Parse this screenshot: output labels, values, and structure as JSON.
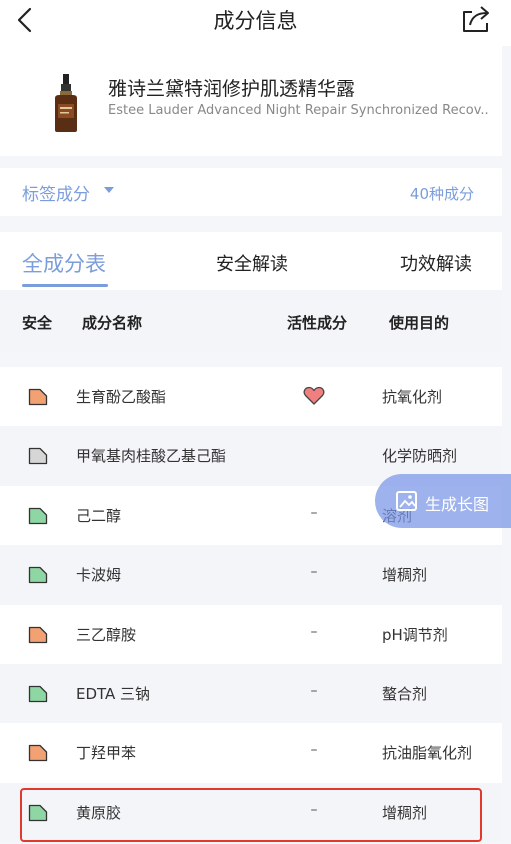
{
  "header": {
    "title": "成分信息",
    "back_icon": "chevron-left-icon",
    "share_icon": "share-icon"
  },
  "product": {
    "name": "雅诗兰黛特润修护肌透精华露",
    "name_en": "Estee Lauder Advanced Night Repair Synchronized Recov..."
  },
  "labels": {
    "link": "标签成分",
    "count": "40种成分"
  },
  "tabs": [
    {
      "label": "全成分表",
      "active": true
    },
    {
      "label": "安全解读",
      "active": false
    },
    {
      "label": "功效解读",
      "active": false
    }
  ],
  "table": {
    "headers": [
      "安全",
      "成分名称",
      "活性成分",
      "使用目的"
    ],
    "rows": [
      {
        "safety_color": "#f2a173",
        "name": "生育酚乙酸酯",
        "active": "heart",
        "purpose": "抗氧化剂"
      },
      {
        "safety_color": "#d6d6d6",
        "name": "甲氧基肉桂酸乙基己酯",
        "active": "",
        "purpose": "化学防晒剂"
      },
      {
        "safety_color": "#8ed6a3",
        "name": "己二醇",
        "active": "–",
        "purpose": "溶剂"
      },
      {
        "safety_color": "#8ed6a3",
        "name": "卡波姆",
        "active": "–",
        "purpose": "增稠剂"
      },
      {
        "safety_color": "#f2a173",
        "name": "三乙醇胺",
        "active": "–",
        "purpose": "pH调节剂"
      },
      {
        "safety_color": "#8ed6a3",
        "name": "EDTA 三钠",
        "active": "–",
        "purpose": "螯合剂"
      },
      {
        "safety_color": "#f2a173",
        "name": "丁羟甲苯",
        "active": "–",
        "purpose": "抗油脂氧化剂"
      },
      {
        "safety_color": "#8ed6a3",
        "name": "黄原胶",
        "active": "–",
        "purpose": "增稠剂"
      }
    ]
  },
  "generate_button": {
    "label": "生成长图",
    "icon": "image-icon"
  },
  "colors": {
    "accent": "#7b9ddb",
    "highlight": "#e2392f",
    "heart": "#f08080"
  }
}
